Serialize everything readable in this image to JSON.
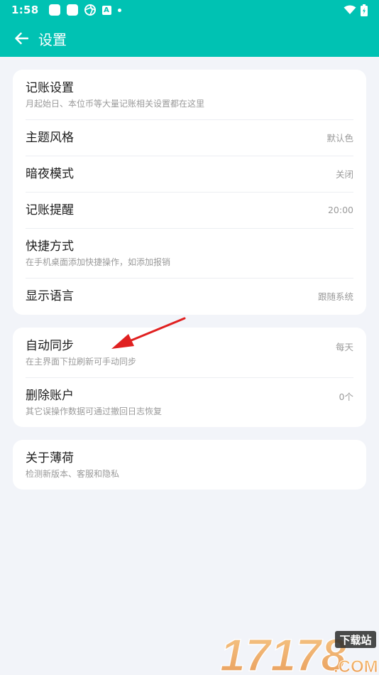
{
  "status": {
    "time": "1:58"
  },
  "header": {
    "title": "设置"
  },
  "sections": [
    {
      "items": [
        {
          "title": "记账设置",
          "subtitle": "月起始日、本位币等大量记账相关设置都在这里",
          "value": ""
        },
        {
          "title": "主题风格",
          "subtitle": "",
          "value": "默认色"
        },
        {
          "title": "暗夜模式",
          "subtitle": "",
          "value": "关闭"
        },
        {
          "title": "记账提醒",
          "subtitle": "",
          "value": "20:00"
        },
        {
          "title": "快捷方式",
          "subtitle": "在手机桌面添加快捷操作，如添加报销",
          "value": ""
        },
        {
          "title": "显示语言",
          "subtitle": "",
          "value": "跟随系统"
        }
      ]
    },
    {
      "items": [
        {
          "title": "自动同步",
          "subtitle": "在主界面下拉刷新可手动同步",
          "value": "每天"
        },
        {
          "title": "删除账户",
          "subtitle": "其它误操作数据可通过撤回日志恢复",
          "value": "0个"
        }
      ]
    },
    {
      "items": [
        {
          "title": "关于薄荷",
          "subtitle": "检测新版本、客服和隐私",
          "value": ""
        }
      ]
    }
  ],
  "watermark": {
    "number": "17178",
    "badge": "下载站",
    "domain": ".COM"
  },
  "colors": {
    "accent": "#00c2b3",
    "background": "#f2f4f9",
    "annotation_arrow": "#e02020"
  },
  "icons": [
    "back-arrow-icon",
    "wifi-icon",
    "battery-icon"
  ]
}
